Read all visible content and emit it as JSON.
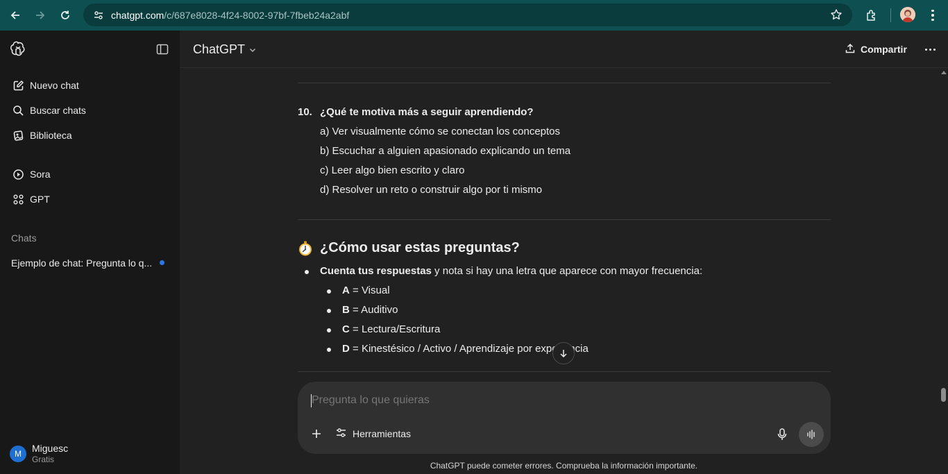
{
  "browser": {
    "url_host": "chatgpt.com",
    "url_path": "/c/687e8028-4f24-8002-97bf-7fbeb24a2abf",
    "icons": [
      "back-icon",
      "forward-icon",
      "reload-icon",
      "site-settings-icon",
      "bookmark-star-icon",
      "extensions-icon",
      "profile-avatar",
      "menu-kebab-icon"
    ]
  },
  "sidebar": {
    "items": [
      {
        "label": "Nuevo chat",
        "icon": "new-chat-icon"
      },
      {
        "label": "Buscar chats",
        "icon": "search-icon"
      },
      {
        "label": "Biblioteca",
        "icon": "library-icon"
      },
      {
        "label": "Sora",
        "icon": "sora-play-icon"
      },
      {
        "label": "GPT",
        "icon": "gpt-grid-icon"
      }
    ],
    "section_label": "Chats",
    "chats": [
      {
        "title": "Ejemplo de chat: Pregunta lo q..."
      }
    ],
    "user": {
      "initial": "M",
      "name": "Miguesc",
      "plan": "Gratis"
    }
  },
  "header": {
    "model": "ChatGPT",
    "share_label": "Compartir"
  },
  "message": {
    "question": {
      "number": "10.",
      "text": "¿Qué te motiva más a seguir aprendiendo?",
      "options": [
        "a) Ver visualmente cómo se conectan los conceptos",
        "b) Escuchar a alguien apasionado explicando un tema",
        "c) Leer algo bien escrito y claro",
        "d) Resolver un reto o construir algo por ti mismo"
      ]
    },
    "section_heading": "¿Cómo usar estas preguntas?",
    "bullet": {
      "bold": "Cuenta tus respuestas",
      "rest": " y nota si hay una letra que aparece con mayor frecuencia:"
    },
    "legend": [
      {
        "letter": "A",
        "text": " = Visual"
      },
      {
        "letter": "B",
        "text": " = Auditivo"
      },
      {
        "letter": "C",
        "text": " = Lectura/Escritura"
      },
      {
        "letter": "D",
        "text": " = Kinestésico / Activo / Aprendizaje por experiencia"
      }
    ]
  },
  "composer": {
    "placeholder": "Pregunta lo que quieras",
    "tools_label": "Herramientas"
  },
  "disclaimer": "ChatGPT puede cometer errores. Comprueba la información importante.",
  "colors": {
    "sidebar_bg": "#181818",
    "main_bg": "#212121",
    "composer_bg": "#303030",
    "browser_bar": "#0e4f52",
    "unread_dot": "#2b78e4",
    "avatar": "#1f6fd1"
  }
}
